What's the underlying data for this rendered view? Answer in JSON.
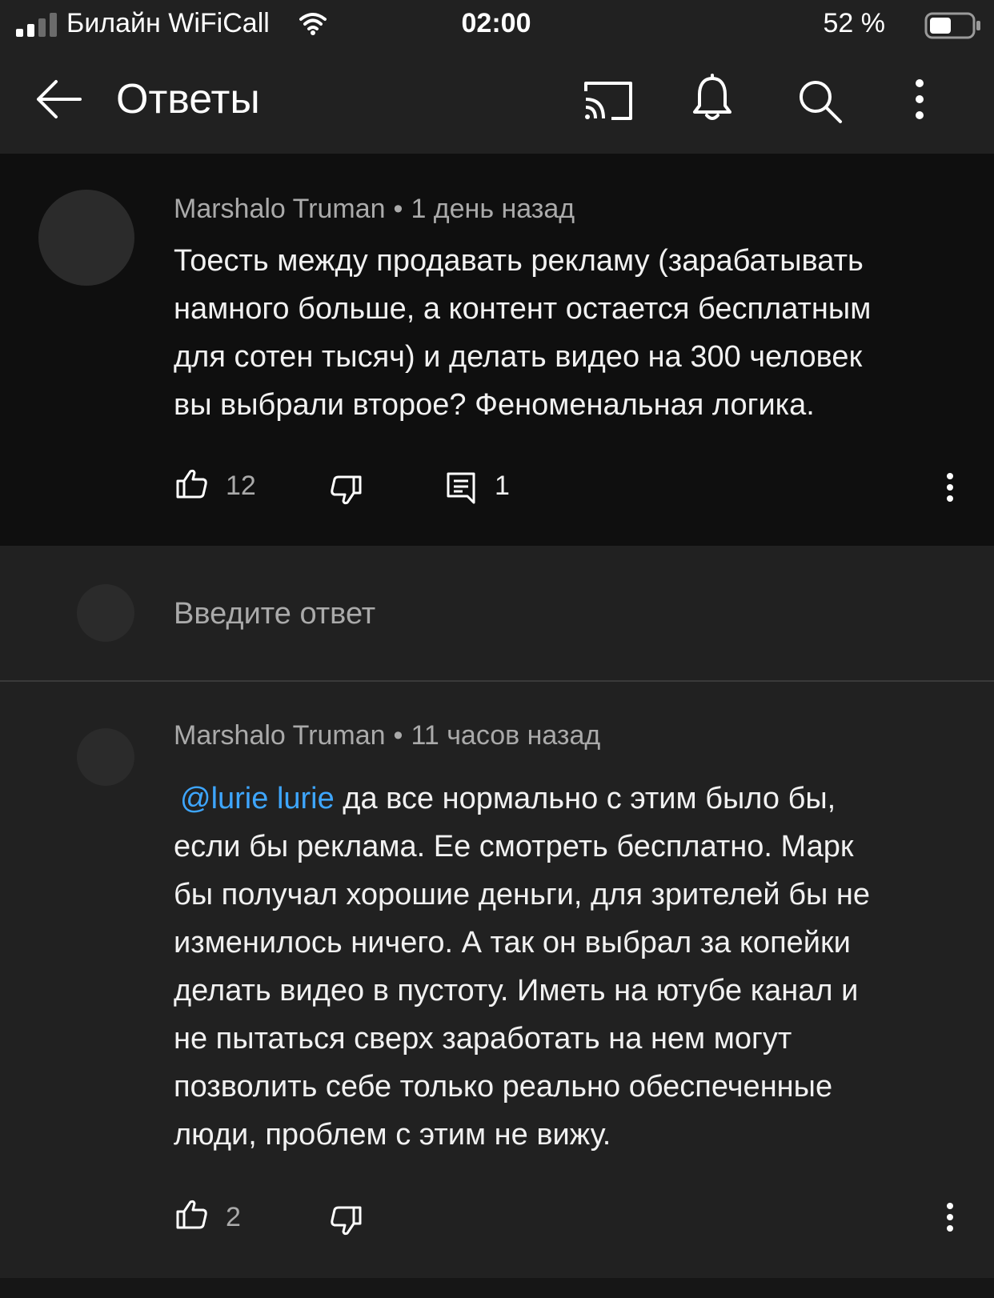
{
  "status_bar": {
    "carrier": "Билайн WiFiCall",
    "time": "02:00",
    "battery": "52 %"
  },
  "app_bar": {
    "title": "Ответы",
    "icons": [
      "back-arrow-icon",
      "cast-icon",
      "bell-icon",
      "search-icon",
      "more-vert-icon"
    ]
  },
  "parent_comment": {
    "author": "Marshalo Truman",
    "separator": "•",
    "time": "1 день назад",
    "text": "Тоесть между продавать рекламу (зарабатывать\nнамного больше, а контент остается бесплатным\nдля сотен тысяч) и делать видео на 300 человек\nвы выбрали второе? Феноменальная логика.",
    "likes": "12",
    "replies": "1"
  },
  "reply_input": {
    "placeholder": "Введите ответ"
  },
  "reply": {
    "author": "Marshalo Truman",
    "separator": "•",
    "time": "11 часов назад",
    "mention": "@lurie lurie",
    "text_first_line": " да все нормально с этим было бы,",
    "text_rest": "если бы реклама. Ее смотреть бесплатно. Марк\nбы получал хорошие деньги, для зрителей бы не\nизменилось ничего. А так он выбрал за копейки\nделать видео в пустоту. Иметь на ютубе канал и\nне пытаться сверх заработать на нем могут\nпозволить себе только реально обеспеченные\nлюди, проблем с этим не вижу.",
    "likes": "2"
  }
}
